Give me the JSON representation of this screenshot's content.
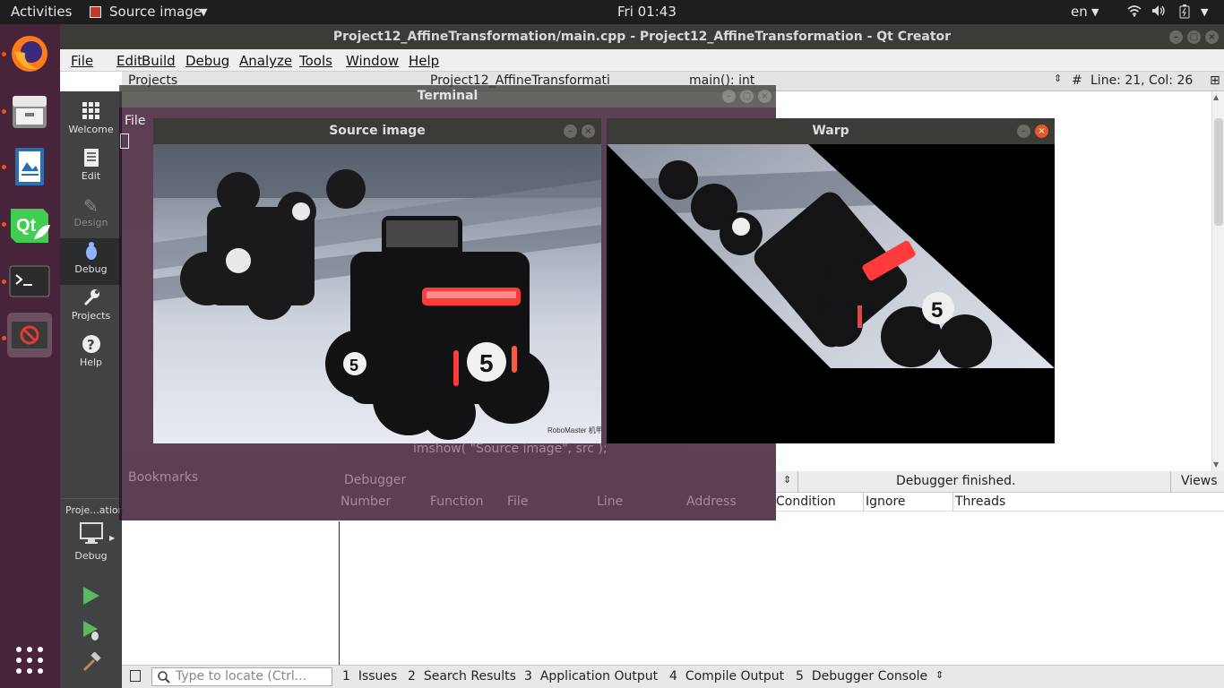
{
  "topbar": {
    "activities": "Activities",
    "app_menu": "Source image",
    "clock": "Fri 01:43",
    "lang": "en"
  },
  "window": {
    "title": "Project12_AffineTransformation/main.cpp - Project12_AffineTransformation - Qt Creator"
  },
  "menu": [
    "File",
    "Edit",
    "Build",
    "Debug",
    "Analyze",
    "Tools",
    "Window",
    "Help"
  ],
  "modes": [
    {
      "label": "Welcome",
      "icon": "grid-icon"
    },
    {
      "label": "Edit",
      "icon": "document-icon"
    },
    {
      "label": "Design",
      "icon": "pencil-icon"
    },
    {
      "label": "Debug",
      "icon": "bug-icon"
    },
    {
      "label": "Projects",
      "icon": "wrench-icon"
    },
    {
      "label": "Help",
      "icon": "help-icon"
    }
  ],
  "kit": {
    "project": "Proje...ation",
    "config": "Debug"
  },
  "editor_toolbar": {
    "projects": "Projects",
    "file": "Project12_AffineTransformati",
    "symbol": "main(): int",
    "position": "Line: 21, Col: 26"
  },
  "terminal": {
    "title": "Terminal",
    "menu_file": "File"
  },
  "source_window": {
    "title": "Source image"
  },
  "warp_window": {
    "title": "Warp"
  },
  "debugger": {
    "status": "Debugger finished.",
    "views": "Views",
    "columns": [
      "Condition",
      "Ignore",
      "Threads"
    ]
  },
  "ghost": {
    "bookmarks": "Bookmarks",
    "debugger": "Debugger",
    "cols": [
      "Number",
      "Function",
      "File",
      "Line",
      "Address"
    ],
    "code": "imshow( \"Source image\", src );"
  },
  "statusbar": {
    "locate_placeholder": "Type to locate (Ctrl...",
    "tabs": [
      {
        "num": "1",
        "label": "Issues"
      },
      {
        "num": "2",
        "label": "Search Results"
      },
      {
        "num": "3",
        "label": "Application Output"
      },
      {
        "num": "4",
        "label": "Compile Output"
      },
      {
        "num": "5",
        "label": "Debugger Console"
      }
    ]
  },
  "image_caption": "RoboMaster 机甲大师"
}
